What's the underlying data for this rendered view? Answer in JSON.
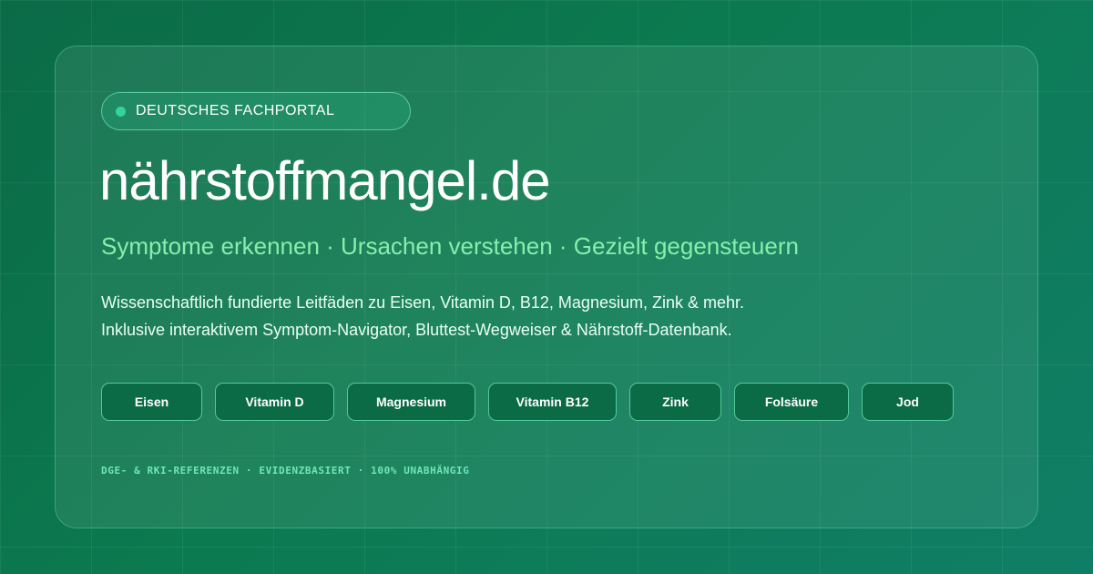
{
  "badge": {
    "label": "DEUTSCHES FACHPORTAL"
  },
  "title": "nährstoffmangel.de",
  "subtitle": "Symptome erkennen · Ursachen verstehen · Gezielt gegensteuern",
  "description": [
    "Wissenschaftlich fundierte Leitfäden zu Eisen, Vitamin D, B12, Magnesium, Zink & mehr.",
    "Inklusive interaktivem Symptom-Navigator, Bluttest-Wegweiser & Nährstoff-Datenbank."
  ],
  "tags": [
    "Eisen",
    "Vitamin D",
    "Magnesium",
    "Vitamin B12",
    "Zink",
    "Folsäure",
    "Jod"
  ],
  "footer": "DGE- & RKI-REFERENZEN · EVIDENZBASIERT · 100% UNABHÄNGIG",
  "colors": {
    "background": "#0c7a50",
    "accent": "#34d399",
    "subtitle": "#86efac",
    "tag_background": "#0b6b47"
  }
}
